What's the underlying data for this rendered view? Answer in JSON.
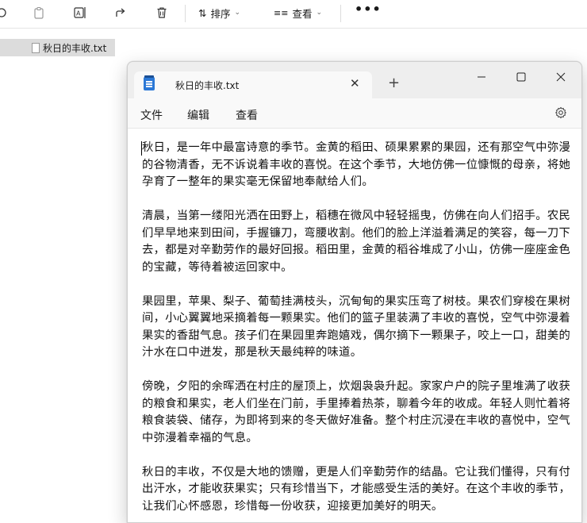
{
  "explorer": {
    "toolbar": {
      "sort_label": "排序",
      "view_label": "查看",
      "more_label": "•••"
    },
    "file_item": {
      "name": "秋日的丰收.txt"
    }
  },
  "notepad": {
    "tab_title": "秋日的丰收.txt",
    "new_tab_symbol": "+",
    "menu": {
      "file": "文件",
      "edit": "编辑",
      "view": "查看"
    },
    "content": [
      "秋日，是一年中最富诗意的季节。金黄的稻田、硕果累累的果园，还有那空气中弥漫的谷物清香，无不诉说着丰收的喜悦。在这个季节，大地仿佛一位慷慨的母亲，将她孕育了一整年的果实毫无保留地奉献给人们。",
      "清晨，当第一缕阳光洒在田野上，稻穗在微风中轻轻摇曳，仿佛在向人们招手。农民们早早地来到田间，手握镰刀，弯腰收割。他们的脸上洋溢着满足的笑容，每一刀下去，都是对辛勤劳作的最好回报。稻田里，金黄的稻谷堆成了小山，仿佛一座座金色的宝藏，等待着被运回家中。",
      "果园里，苹果、梨子、葡萄挂满枝头，沉甸甸的果实压弯了树枝。果农们穿梭在果树间，小心翼翼地采摘着每一颗果实。他们的篮子里装满了丰收的喜悦，空气中弥漫着果实的香甜气息。孩子们在果园里奔跑嬉戏，偶尔摘下一颗果子，咬上一口，甜美的汁水在口中迸发，那是秋天最纯粹的味道。",
      "傍晚，夕阳的余晖洒在村庄的屋顶上，炊烟袅袅升起。家家户户的院子里堆满了收获的粮食和果实，老人们坐在门前，手里捧着热茶，聊着今年的收成。年轻人则忙着将粮食装袋、储存，为即将到来的冬天做好准备。整个村庄沉浸在丰收的喜悦中，空气中弥漫着幸福的气息。",
      "秋日的丰收，不仅是大地的馈赠，更是人们辛勤劳作的结晶。它让我们懂得，只有付出汗水，才能收获果实；只有珍惜当下，才能感受生活的美好。在这个丰收的季节，让我们心怀感恩，珍惜每一份收获，迎接更加美好的明天。"
    ]
  }
}
